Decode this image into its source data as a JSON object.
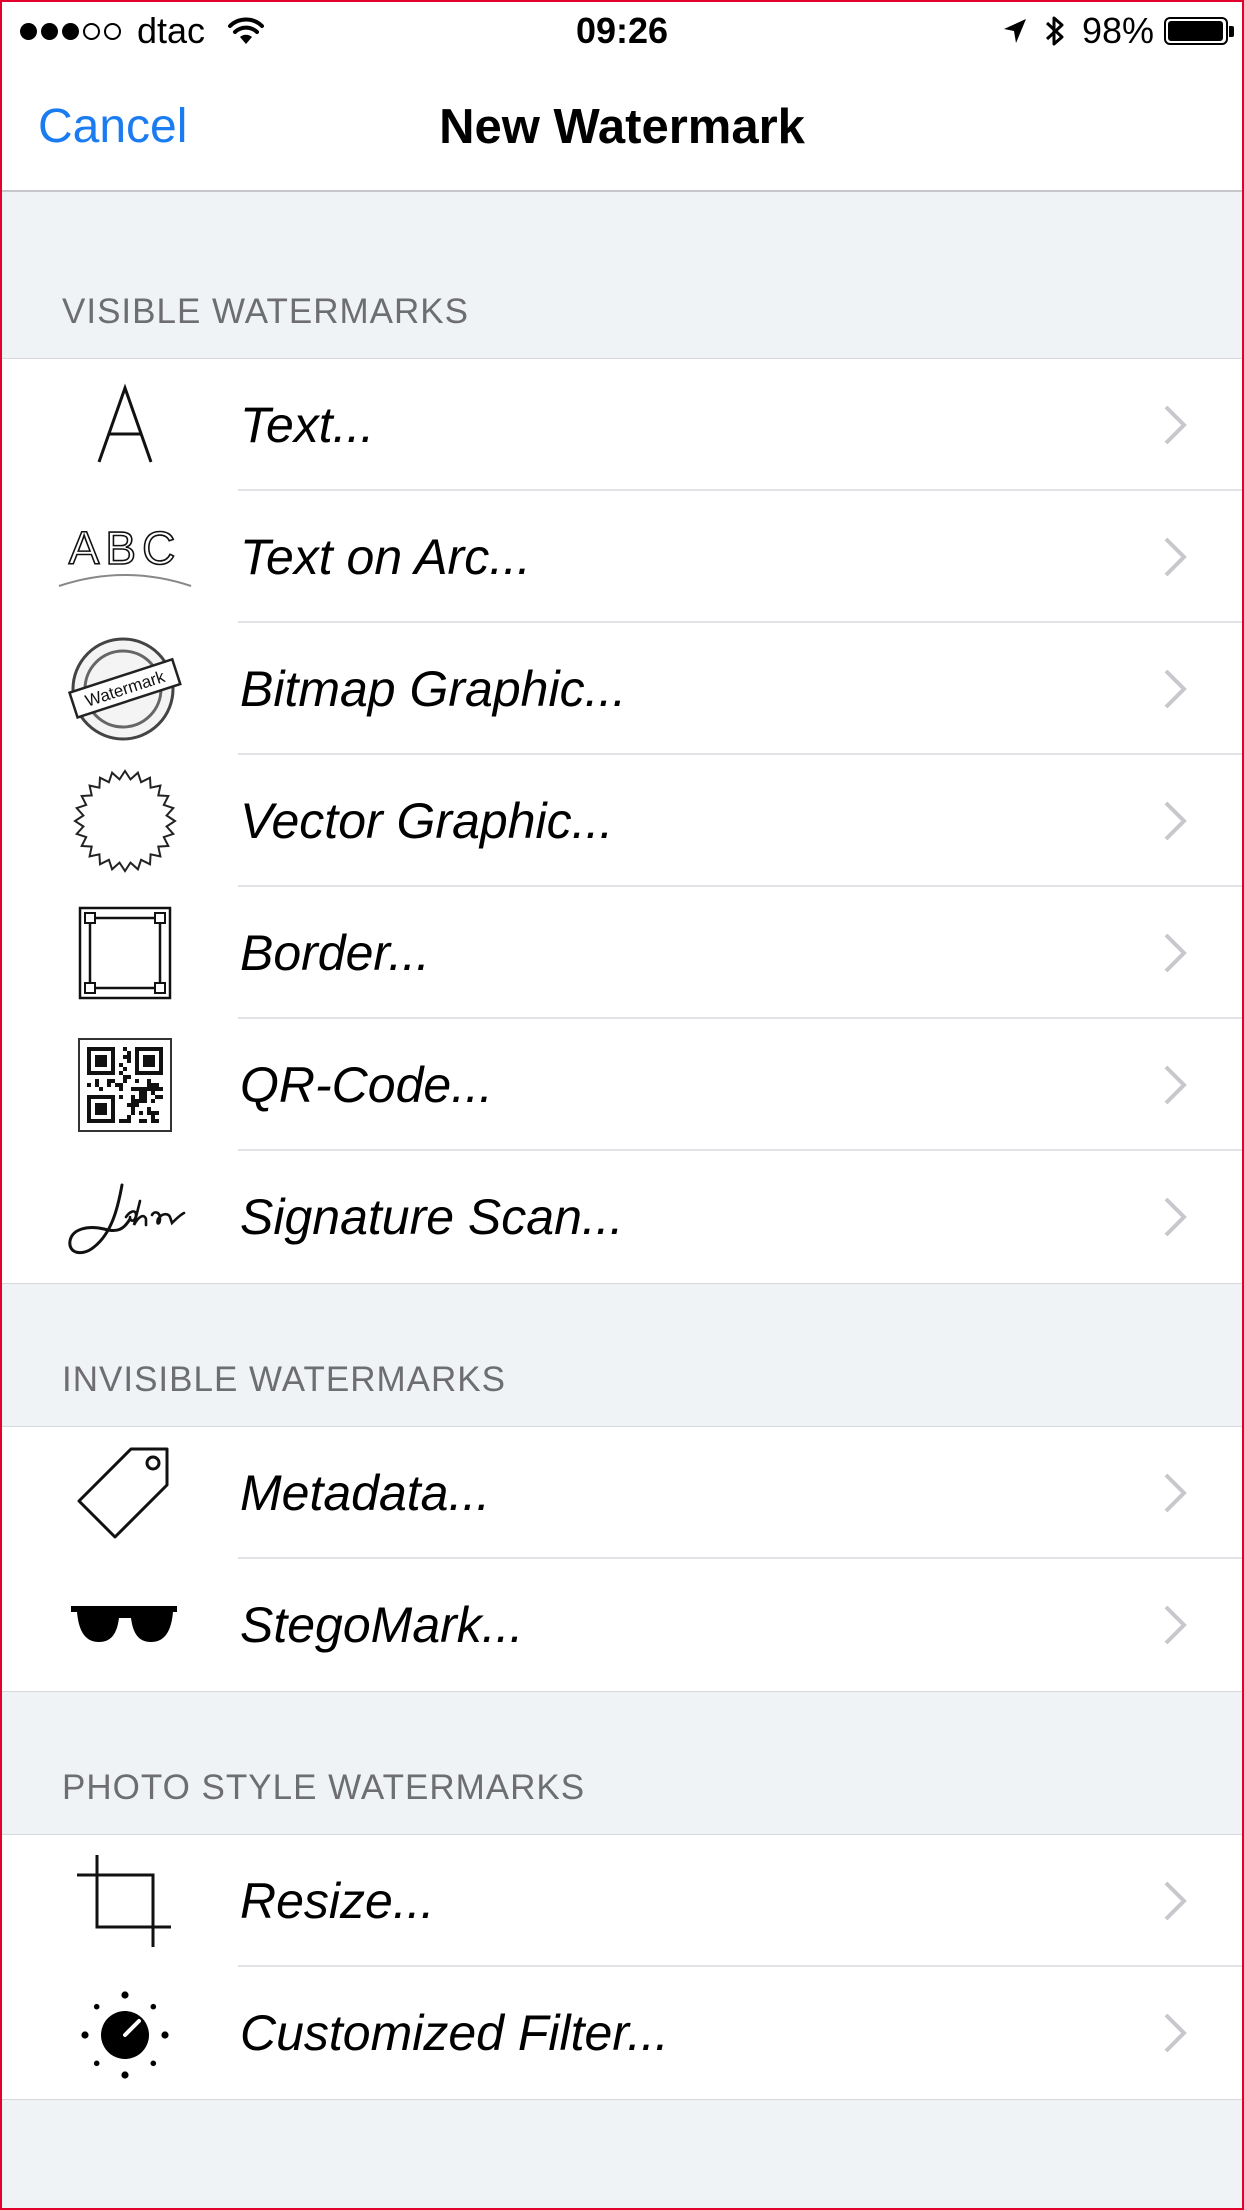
{
  "status_bar": {
    "carrier": "dtac",
    "time": "09:26",
    "battery": "98%",
    "battery_level": 0.98,
    "signal_bars_filled": 3,
    "signal_bars_total": 5,
    "icons": [
      "wifi-icon",
      "location-arrow-icon",
      "bluetooth-icon",
      "battery-icon"
    ]
  },
  "nav": {
    "cancel_label": "Cancel",
    "title": "New Watermark",
    "accent_color": "#1a7cf0"
  },
  "sections": [
    {
      "header": "VISIBLE WATERMARKS",
      "items": [
        {
          "label": "Text...",
          "icon": "letter-a-icon"
        },
        {
          "label": "Text on Arc...",
          "icon": "text-arc-icon"
        },
        {
          "label": "Bitmap Graphic...",
          "icon": "watermark-stamp-icon"
        },
        {
          "label": "Vector Graphic...",
          "icon": "starburst-seal-icon"
        },
        {
          "label": "Border...",
          "icon": "border-frame-icon"
        },
        {
          "label": "QR-Code...",
          "icon": "qr-code-icon"
        },
        {
          "label": "Signature Scan...",
          "icon": "signature-icon"
        }
      ]
    },
    {
      "header": "INVISIBLE WATERMARKS",
      "items": [
        {
          "label": "Metadata...",
          "icon": "tag-icon"
        },
        {
          "label": "StegoMark...",
          "icon": "sunglasses-icon"
        }
      ]
    },
    {
      "header": "PHOTO STYLE WATERMARKS",
      "items": [
        {
          "label": "Resize...",
          "icon": "crop-icon"
        },
        {
          "label": "Customized Filter...",
          "icon": "filter-dial-icon"
        }
      ]
    }
  ],
  "stamp_icon_text": "Watermark",
  "signature_icon_text": "John",
  "arc_icon_text": "ABC"
}
